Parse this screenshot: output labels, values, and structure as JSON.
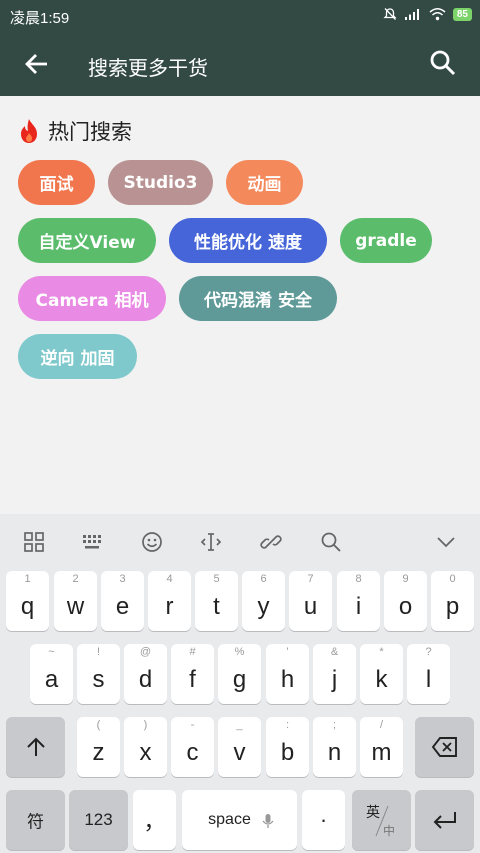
{
  "status_bar": {
    "time": "凌晨1:59",
    "battery": "85"
  },
  "toolbar": {
    "title": "搜索更多干货"
  },
  "hot": {
    "title": "热门搜索",
    "tags": [
      {
        "label": "面试",
        "color": "#f2764d"
      },
      {
        "label": "Studio3",
        "color": "#b99394"
      },
      {
        "label": "动画",
        "color": "#f4895b"
      },
      {
        "label": "自定义View",
        "color": "#5bbd6b"
      },
      {
        "label": "性能优化 速度",
        "color": "#4565d8"
      },
      {
        "label": "gradle",
        "color": "#5bbd6b"
      },
      {
        "label": "Camera 相机",
        "color": "#e98ae4"
      },
      {
        "label": "代码混淆 安全",
        "color": "#5f9a99"
      },
      {
        "label": "逆向 加固",
        "color": "#7fc9cc"
      }
    ]
  },
  "keyboard": {
    "row1": [
      {
        "main": "q",
        "sub": "1"
      },
      {
        "main": "w",
        "sub": "2"
      },
      {
        "main": "e",
        "sub": "3"
      },
      {
        "main": "r",
        "sub": "4"
      },
      {
        "main": "t",
        "sub": "5"
      },
      {
        "main": "y",
        "sub": "6"
      },
      {
        "main": "u",
        "sub": "7"
      },
      {
        "main": "i",
        "sub": "8"
      },
      {
        "main": "o",
        "sub": "9"
      },
      {
        "main": "p",
        "sub": "0"
      }
    ],
    "row2": [
      {
        "main": "a",
        "sub": "~"
      },
      {
        "main": "s",
        "sub": "!"
      },
      {
        "main": "d",
        "sub": "@"
      },
      {
        "main": "f",
        "sub": "#"
      },
      {
        "main": "g",
        "sub": "%"
      },
      {
        "main": "h",
        "sub": "'"
      },
      {
        "main": "j",
        "sub": "&"
      },
      {
        "main": "k",
        "sub": "*"
      },
      {
        "main": "l",
        "sub": "?"
      }
    ],
    "row3": [
      {
        "main": "z",
        "sub": "("
      },
      {
        "main": "x",
        "sub": ")"
      },
      {
        "main": "c",
        "sub": "-"
      },
      {
        "main": "v",
        "sub": "_"
      },
      {
        "main": "b",
        "sub": ":"
      },
      {
        "main": "n",
        "sub": ";"
      },
      {
        "main": "m",
        "sub": "/"
      }
    ],
    "bottom": {
      "symbol": "符",
      "numbers": "123",
      "comma": "，",
      "space": "space",
      "period": "·",
      "lang_top": "英",
      "lang_bottom": "中"
    }
  }
}
